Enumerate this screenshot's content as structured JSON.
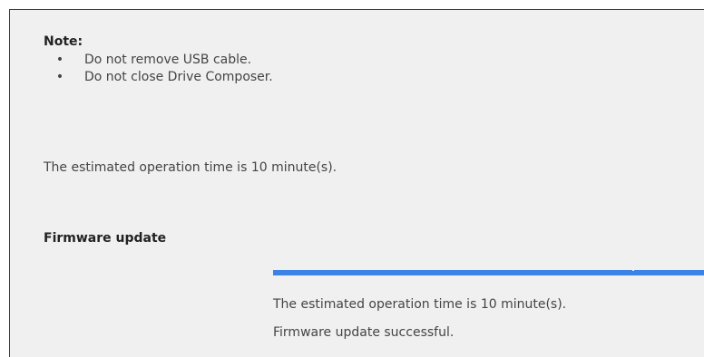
{
  "note": {
    "heading": "Note:",
    "items": [
      "Do not remove USB cable.",
      "Do not close Drive Composer."
    ]
  },
  "estimate": {
    "text": "The estimated operation time is 10 minute(s)."
  },
  "firmware_update": {
    "title": "Firmware update",
    "progress": 1.0,
    "status_lines": [
      "The estimated operation time is 10 minute(s).",
      "Firmware update successful."
    ]
  },
  "colors": {
    "progress_fill": "#3b82e6",
    "background": "#f0f0f0"
  }
}
